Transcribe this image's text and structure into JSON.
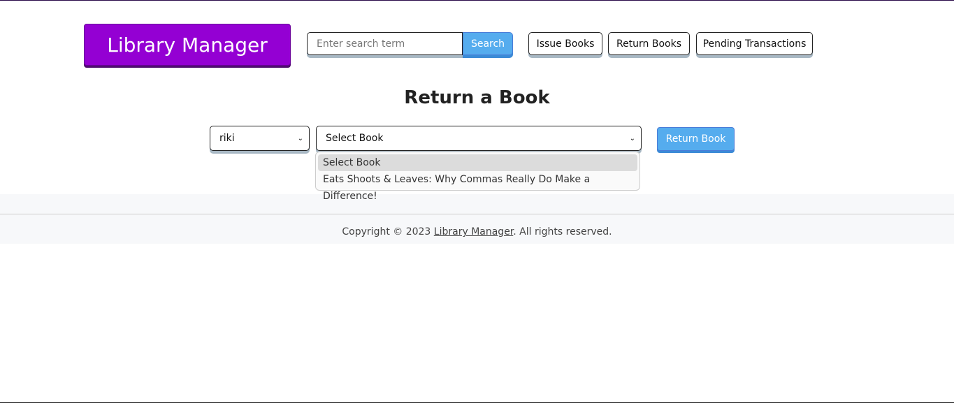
{
  "header": {
    "brand": "Library Manager",
    "search_placeholder": "Enter search term",
    "search_label": "Search",
    "nav": [
      "Issue Books",
      "Return Books",
      "Pending Transactions"
    ]
  },
  "main": {
    "title": "Return a Book",
    "user_select": "riki",
    "book_select": "Select Book",
    "return_label": "Return Book",
    "book_options": [
      "Select Book",
      "Eats Shoots & Leaves: Why Commas Really Do Make a Difference!"
    ]
  },
  "footer": {
    "prefix": "Copyright © 2023 ",
    "link": "Library Manager",
    "suffix": ". All rights reserved."
  }
}
